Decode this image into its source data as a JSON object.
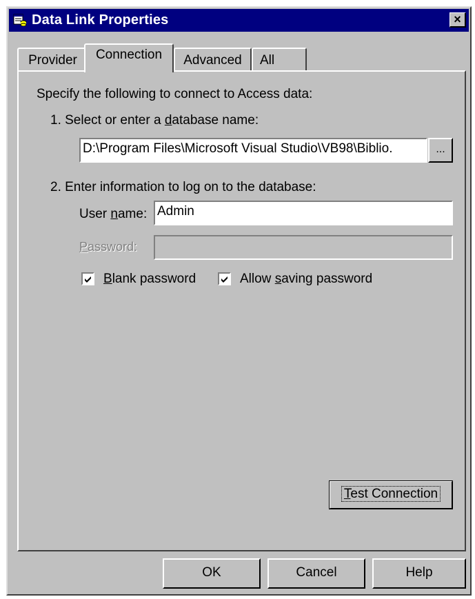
{
  "window": {
    "title": "Data Link Properties",
    "close_glyph": "×"
  },
  "tabs": [
    {
      "label": "Provider",
      "active": false
    },
    {
      "label": "Connection",
      "active": true
    },
    {
      "label": "Advanced",
      "active": false
    },
    {
      "label": "All",
      "active": false
    }
  ],
  "connection": {
    "intro": "Specify the following to connect to Access data:",
    "step1": {
      "pre": "1. Select or enter a ",
      "key": "d",
      "post": "atabase name:"
    },
    "database_path": "D:\\Program Files\\Microsoft Visual Studio\\VB98\\Biblio.",
    "browse_label": "...",
    "step2": "2. Enter information to log on to the database:",
    "username": {
      "pre": "User ",
      "key": "n",
      "post": "ame:",
      "value": "Admin"
    },
    "password": {
      "key": "P",
      "post": "assword:",
      "value": ""
    },
    "blank_password": {
      "key": "B",
      "post": "lank password",
      "checked": true
    },
    "allow_saving": {
      "pre": "Allow ",
      "key": "s",
      "post": "aving password",
      "checked": true
    },
    "test_connection": {
      "key": "T",
      "post": "est Connection"
    }
  },
  "buttons": {
    "ok": "OK",
    "cancel": "Cancel",
    "help": "Help"
  },
  "colors": {
    "titlebar": "#000080",
    "face": "#c0c0c0"
  }
}
